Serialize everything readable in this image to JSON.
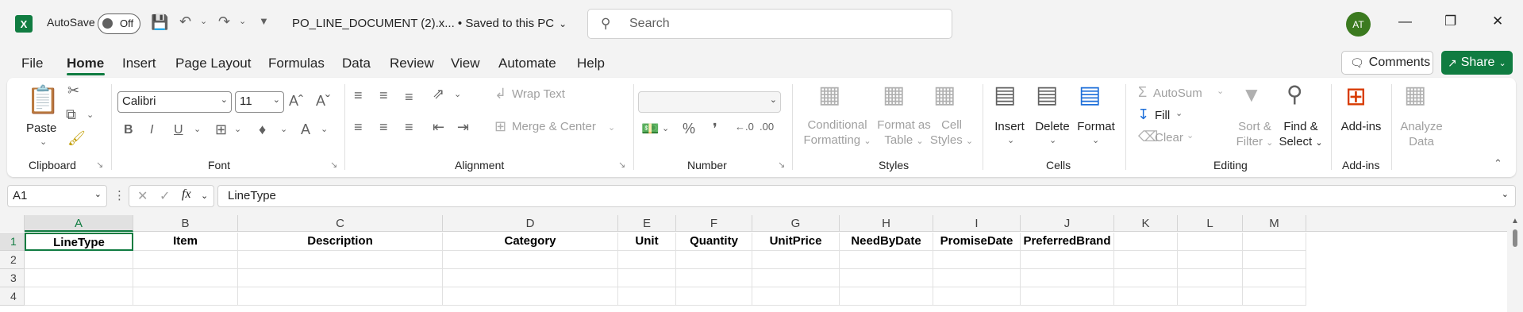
{
  "title_bar": {
    "app_logo": "X",
    "autosave_label": "AutoSave",
    "autosave_state": "Off",
    "document_title": "PO_LINE_DOCUMENT (2).x...  •  Saved to this PC",
    "search_placeholder": "Search",
    "avatar_initials": "AT"
  },
  "menu": {
    "tabs": [
      "File",
      "Home",
      "Insert",
      "Page Layout",
      "Formulas",
      "Data",
      "Review",
      "View",
      "Automate",
      "Help"
    ],
    "active_tab": "Home",
    "comments_label": "Comments",
    "share_label": "Share"
  },
  "ribbon": {
    "clipboard": {
      "paste": "Paste",
      "label": "Clipboard"
    },
    "font": {
      "name": "Calibri",
      "size": "11",
      "label": "Font"
    },
    "alignment": {
      "wrap": "Wrap Text",
      "merge": "Merge & Center",
      "label": "Alignment"
    },
    "number": {
      "label": "Number"
    },
    "styles": {
      "conditional_1": "Conditional",
      "conditional_2": "Formatting",
      "format_table_1": "Format as",
      "format_table_2": "Table",
      "cell_styles_1": "Cell",
      "cell_styles_2": "Styles",
      "label": "Styles"
    },
    "cells": {
      "insert": "Insert",
      "delete": "Delete",
      "format": "Format",
      "label": "Cells"
    },
    "editing": {
      "autosum": "AutoSum",
      "fill": "Fill",
      "clear": "Clear",
      "sort_1": "Sort &",
      "sort_2": "Filter",
      "find_1": "Find &",
      "find_2": "Select",
      "label": "Editing"
    },
    "addins": {
      "addins": "Add-ins",
      "label": "Add-ins"
    },
    "analyze": {
      "line1": "Analyze",
      "line2": "Data"
    }
  },
  "formula_bar": {
    "name_box": "A1",
    "fx": "fx",
    "value": "LineType"
  },
  "sheet": {
    "columns": [
      "A",
      "B",
      "C",
      "D",
      "E",
      "F",
      "G",
      "H",
      "I",
      "J",
      "K",
      "L",
      "M"
    ],
    "rows": [
      "1",
      "2",
      "3",
      "4"
    ],
    "header_cells": [
      "LineType",
      "Item",
      "Description",
      "Category",
      "Unit",
      "Quantity",
      "UnitPrice",
      "NeedByDate",
      "PromiseDate",
      "PreferredBrand",
      "",
      "",
      ""
    ]
  },
  "colors": {
    "accent": "#107c41",
    "avatar": "#3b7a1f",
    "addins_icon": "#d83b01"
  }
}
